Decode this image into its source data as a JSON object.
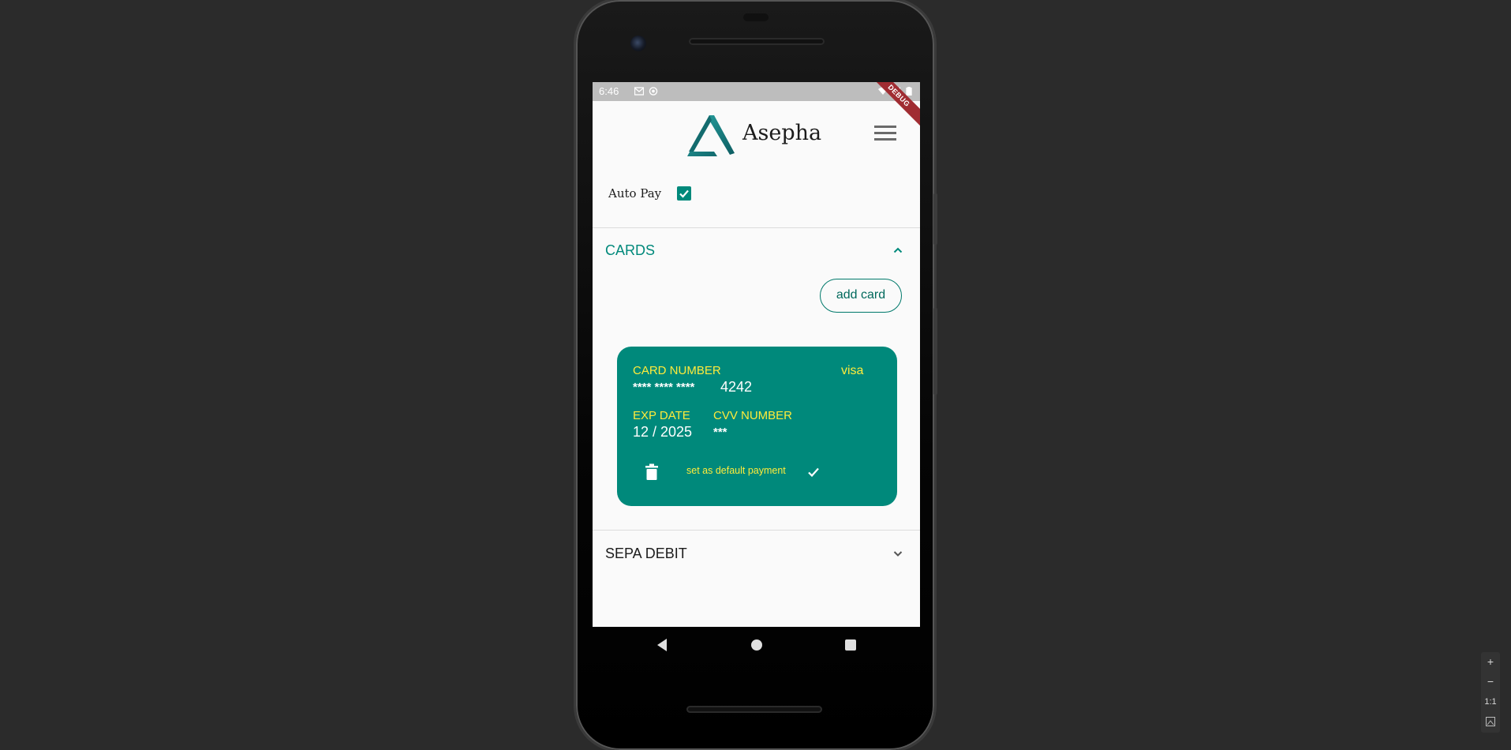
{
  "status_bar": {
    "time": "6:46",
    "ribbon": "DEBUG"
  },
  "app_bar": {
    "brand": "Asepha",
    "menu_icon": "hamburger-menu-icon"
  },
  "autopay": {
    "label": "Auto Pay",
    "checked": true
  },
  "cards_section": {
    "title": "CARDS",
    "expanded": true,
    "add_button": "add card",
    "card": {
      "number_label": "CARD NUMBER",
      "brand": "visa",
      "masked_number": "**** **** ****",
      "last4": "4242",
      "exp_label": "EXP DATE",
      "exp_value": "12 / 2025",
      "cvv_label": "CVV NUMBER",
      "cvv_value": "***",
      "default_label": "set as default payment",
      "is_default": true
    }
  },
  "sepa_section": {
    "title": "SEPA DEBIT",
    "expanded": false
  },
  "colors": {
    "accent": "#00897b",
    "card_label": "#ffeb3b",
    "status_bar": "#bdbdbd",
    "background": "#2b2b2b"
  },
  "zoom_controls": {
    "zoom_in": "+",
    "zoom_out": "−",
    "actual_size": "1:1"
  }
}
